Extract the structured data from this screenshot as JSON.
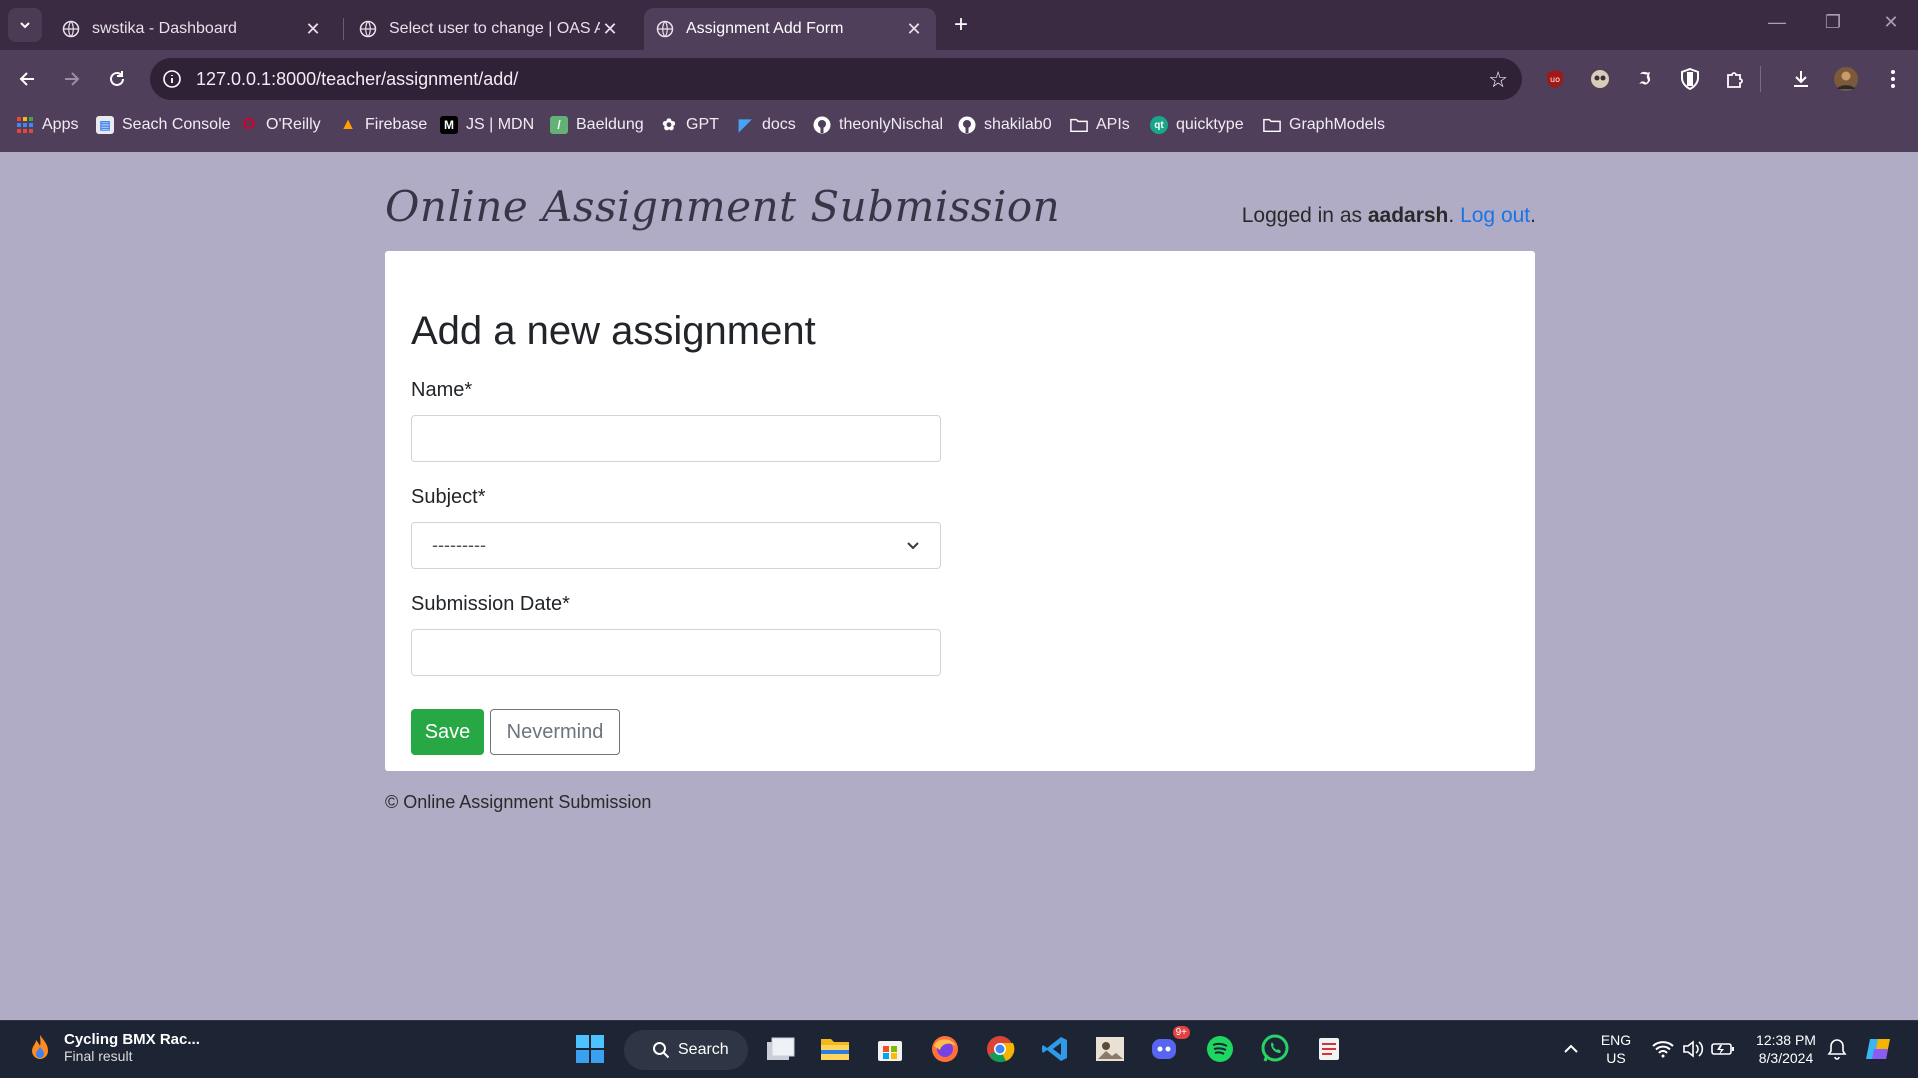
{
  "browser": {
    "tabs": [
      {
        "title": "swstika - Dashboard",
        "active": false
      },
      {
        "title": "Select user to change | OAS Adi",
        "active": false
      },
      {
        "title": "Assignment Add Form",
        "active": true
      }
    ],
    "url": "127.0.0.1:8000/teacher/assignment/add/",
    "bookmarks": [
      {
        "label": "Apps",
        "icon": "apps-grid-icon"
      },
      {
        "label": "Seach Console",
        "icon": "search-console-icon"
      },
      {
        "label": "O'Reilly",
        "icon": "oreilly-icon"
      },
      {
        "label": "Firebase",
        "icon": "firebase-icon"
      },
      {
        "label": "JS | MDN",
        "icon": "mdn-icon"
      },
      {
        "label": "Baeldung",
        "icon": "baeldung-icon"
      },
      {
        "label": "GPT",
        "icon": "gpt-icon"
      },
      {
        "label": "docs",
        "icon": "flutter-icon"
      },
      {
        "label": "theonlyNischal",
        "icon": "github-icon"
      },
      {
        "label": "shakilab0",
        "icon": "github-icon"
      },
      {
        "label": "APIs",
        "icon": "folder-icon"
      },
      {
        "label": "quicktype",
        "icon": "quicktype-icon"
      },
      {
        "label": "GraphModels",
        "icon": "folder-icon"
      }
    ]
  },
  "header": {
    "brand": "Online Assignment Submission",
    "logged_in_prefix": "Logged in as ",
    "username": "aadarsh",
    "separator": ".",
    "logout_label": "Log out",
    "suffix": "."
  },
  "form": {
    "title": "Add a new assignment",
    "name_label": "Name*",
    "name_value": "",
    "subject_label": "Subject*",
    "subject_selected": "---------",
    "date_label": "Submission Date*",
    "date_value": "",
    "save_label": "Save",
    "cancel_label": "Nevermind"
  },
  "footer": {
    "text": "© Online Assignment Submission"
  },
  "taskbar": {
    "media_title": "Cycling BMX Rac...",
    "media_subtitle": "Final result",
    "search_label": "Search",
    "lang_top": "ENG",
    "lang_bottom": "US",
    "time": "12:38 PM",
    "date": "8/3/2024",
    "discord_badge": "9+"
  },
  "colors": {
    "page_bg": "#b0acc5",
    "tab_bar": "#3a2b43",
    "toolbar": "#4f3f5a",
    "save_button": "#28a745",
    "link": "#1a73e8"
  }
}
